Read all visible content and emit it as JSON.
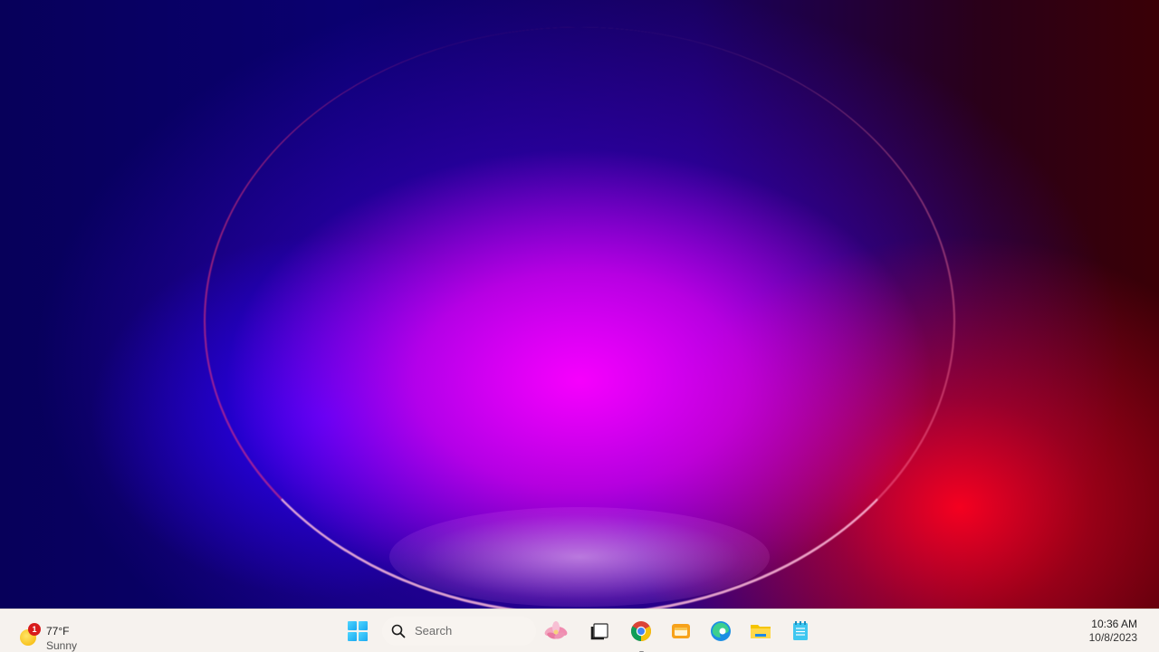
{
  "weather": {
    "temperature": "77°F",
    "condition": "Sunny",
    "badge_count": "1"
  },
  "search": {
    "placeholder": "Search"
  },
  "taskbar": {
    "apps": [
      {
        "name": "Start",
        "icon": "windows-logo-icon"
      },
      {
        "name": "Copilot flower",
        "icon": "flower-icon"
      },
      {
        "name": "Task View",
        "icon": "task-view-icon"
      },
      {
        "name": "Google Chrome",
        "icon": "chrome-icon",
        "running": true
      },
      {
        "name": "Folder app",
        "icon": "orange-folder-icon"
      },
      {
        "name": "Microsoft Edge",
        "icon": "edge-icon"
      },
      {
        "name": "File Explorer",
        "icon": "file-explorer-icon"
      },
      {
        "name": "Notepad",
        "icon": "notepad-icon"
      }
    ]
  },
  "clock": {
    "time": "10:36 AM",
    "date": "10/8/2023"
  },
  "colors": {
    "taskbar_bg": "#f6f2ee",
    "accent_blue": "#1aa8f0",
    "badge_red": "#d81b1b"
  }
}
